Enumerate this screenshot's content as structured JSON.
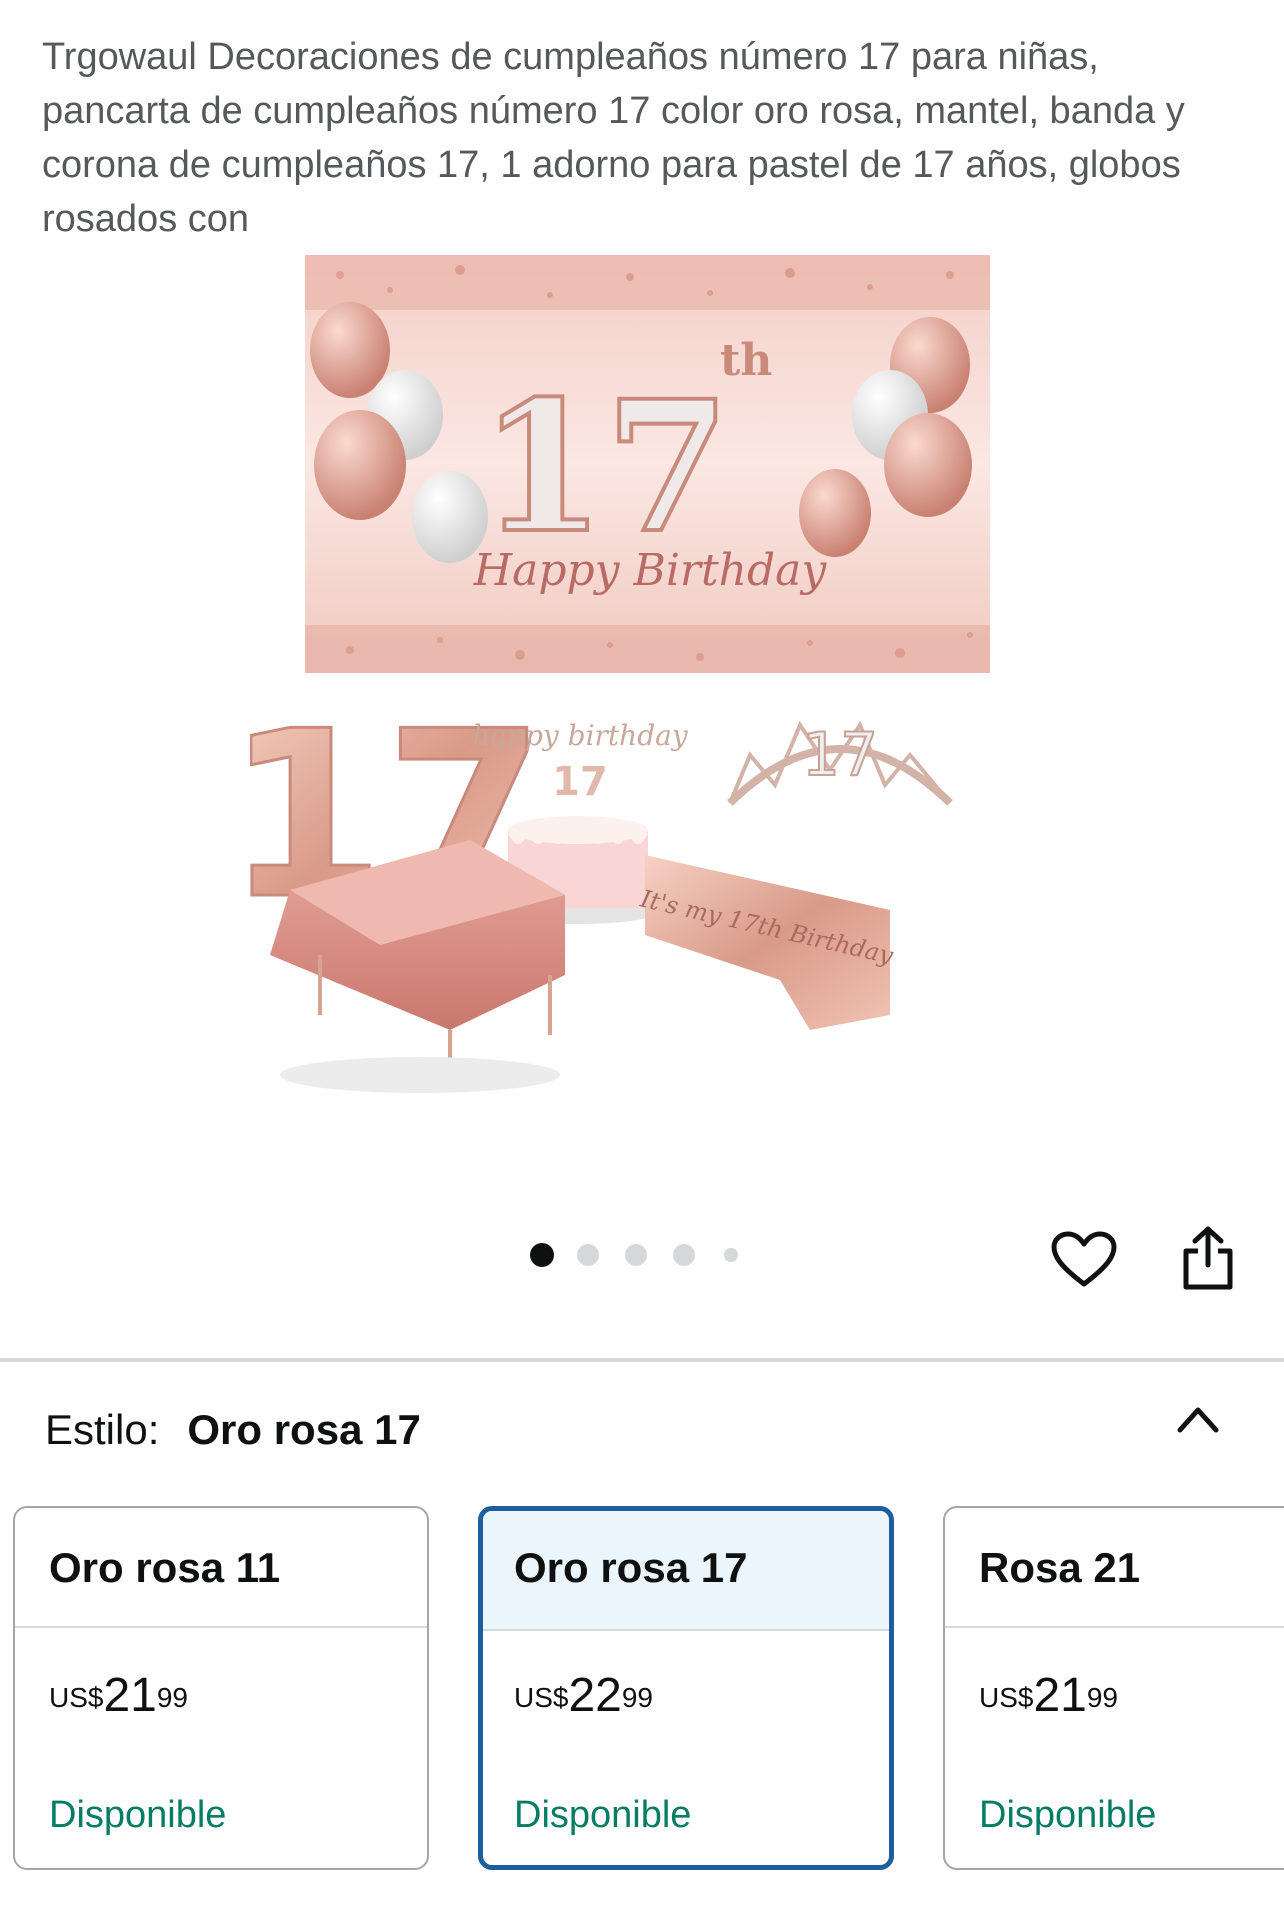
{
  "product": {
    "title": "Trgowaul Decoraciones de cumpleaños número 17 para niñas, pancarta de cumpleaños número 17 color oro rosa, mantel, banda y corona de cumpleaños 17, 1 adorno para pastel de 17 años, globos rosados con"
  },
  "image": {
    "banner_number": "17",
    "banner_suffix": "th",
    "banner_text": "Happy Birthday",
    "cake_topper_text": "happy birthday",
    "cake_topper_number": "17",
    "tiara_number": "17",
    "sash_text": "It's my 17th Birthday",
    "balloon_number": "17",
    "carousel_total": 5,
    "carousel_active": 1
  },
  "style_selector": {
    "label": "Estilo:",
    "selected": "Oro rosa 17"
  },
  "options": [
    {
      "name": "Oro rosa 11",
      "currency": "US$",
      "whole": "21",
      "cents": "99",
      "availability": "Disponible",
      "selected": false
    },
    {
      "name": "Oro rosa 17",
      "currency": "US$",
      "whole": "22",
      "cents": "99",
      "availability": "Disponible",
      "selected": true
    },
    {
      "name": "Rosa 21",
      "currency": "US$",
      "whole": "21",
      "cents": "99",
      "availability": "Disponible",
      "selected": false
    }
  ],
  "colors": {
    "selected_border": "#1f5e9e",
    "selected_bg": "#eaf6fb",
    "available": "#067d62",
    "rose_gold": "#e8b4a4"
  },
  "icons": [
    "heart-icon",
    "share-icon",
    "chevron-up-icon"
  ]
}
